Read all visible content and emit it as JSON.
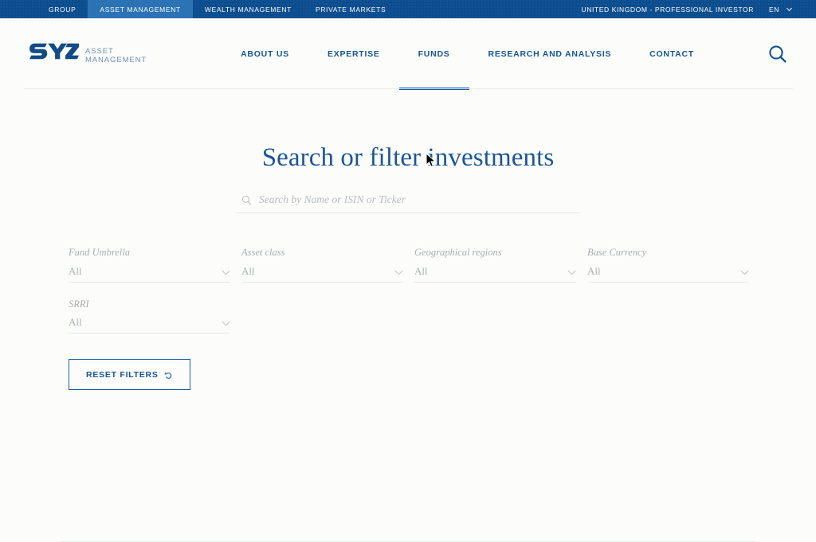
{
  "topbar": {
    "items": [
      {
        "label": "GROUP",
        "active": false
      },
      {
        "label": "ASSET MANAGEMENT",
        "active": true
      },
      {
        "label": "WEALTH MANAGEMENT",
        "active": false
      },
      {
        "label": "PRIVATE MARKETS",
        "active": false
      }
    ],
    "locale": "UNITED KINGDOM - PROFESSIONAL INVESTOR",
    "language": "EN",
    "language_caret_icon": "chevron-down-icon",
    "background_color": "#0c4d8f",
    "active_tab_color": "#2b73b5"
  },
  "header": {
    "logo": {
      "mark": "SYZ",
      "line1": "ASSET",
      "line2": "MANAGEMENT",
      "mark_color": "#114b86",
      "text_color": "#6e8fb3"
    },
    "nav": [
      {
        "label": "ABOUT US",
        "active": false
      },
      {
        "label": "EXPERTISE",
        "active": false
      },
      {
        "label": "FUNDS",
        "active": true
      },
      {
        "label": "RESEARCH AND ANALYSIS",
        "active": false
      },
      {
        "label": "CONTACT",
        "active": false
      }
    ],
    "nav_color": "#14559b",
    "active_underline_color": "#0f5da4",
    "search_icon": "search-icon"
  },
  "main": {
    "title": "Search or filter investments",
    "title_color": "#1b5696",
    "search": {
      "icon": "search-icon",
      "placeholder": "Search by Name or ISIN or Ticker",
      "value": ""
    },
    "filters": [
      {
        "label": "Fund Umbrella",
        "value": "All",
        "chevron_icon": "chevron-down-icon"
      },
      {
        "label": "Asset class",
        "value": "All",
        "chevron_icon": "chevron-down-icon"
      },
      {
        "label": "Geographical regions",
        "value": "All",
        "chevron_icon": "chevron-down-icon"
      },
      {
        "label": "Base Currency",
        "value": "All",
        "chevron_icon": "chevron-down-icon"
      },
      {
        "label": "SRRI",
        "value": "All",
        "chevron_icon": "chevron-down-icon"
      }
    ],
    "reset_button": {
      "label": "RESET FILTERS",
      "icon": "undo-arrow-icon",
      "border_color": "#1a5ea5",
      "text_color": "#14559b"
    }
  }
}
